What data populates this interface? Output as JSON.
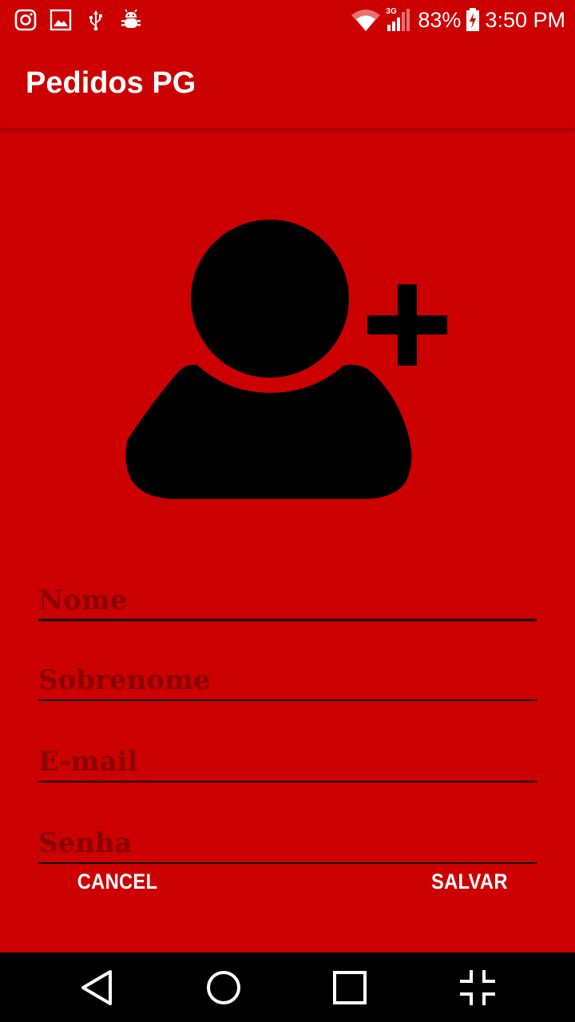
{
  "status_bar": {
    "left_icons": [
      "instagram-icon",
      "gallery-icon",
      "usb-icon",
      "android-debug-icon"
    ],
    "network_type": "3G",
    "battery_percent": "83%",
    "time": "3:50 PM"
  },
  "app_bar": {
    "title": "Pedidos PG"
  },
  "form": {
    "nome_placeholder": "Nome",
    "sobrenome_placeholder": "Sobrenome",
    "email_placeholder": "E-mail",
    "senha_placeholder": "Senha"
  },
  "actions": {
    "cancel_label": "CANCEL",
    "save_label": "SALVAR"
  },
  "nav_bar": {
    "buttons": [
      "back-icon",
      "home-icon",
      "recents-icon",
      "collapse-icon"
    ]
  },
  "colors": {
    "primary": "#cc0000",
    "text_on_primary": "#ffffff",
    "hint": "#8a0000",
    "nav_bar": "#000000"
  }
}
